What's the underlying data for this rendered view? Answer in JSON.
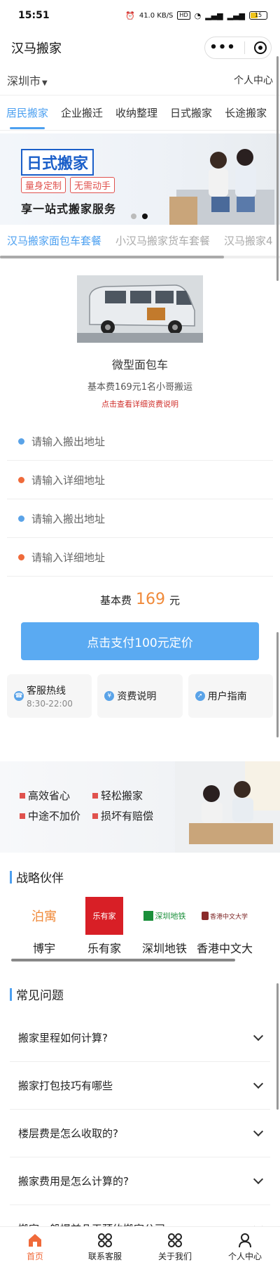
{
  "status_bar": {
    "time": "15:51",
    "speed": "41.0 KB/S",
    "hd": "HD",
    "battery": "15"
  },
  "nav": {
    "title": "汉马搬家",
    "more_icon": "more-dots-icon",
    "close_icon": "target-close-icon"
  },
  "header": {
    "city": "深圳市",
    "personal_center": "个人中心"
  },
  "tabs": [
    "居民搬家",
    "企业搬迁",
    "收纳整理",
    "日式搬家",
    "长途搬家"
  ],
  "banner": {
    "title": "日式搬家",
    "tags": [
      "量身定制",
      "无需动手"
    ],
    "subtitle": "享一站式搬家服务"
  },
  "package_tabs": [
    "汉马搬家面包车套餐",
    "小汉马搬家货车套餐",
    "汉马搬家4"
  ],
  "vehicle": {
    "name": "微型面包车",
    "desc": "基本费169元1名小哥搬运",
    "fee_link": "点击查看详细资费说明"
  },
  "addresses": [
    {
      "placeholder": "请输入搬出地址",
      "color": "blue"
    },
    {
      "placeholder": "请输入详细地址",
      "color": "orange"
    },
    {
      "placeholder": "请输入搬出地址",
      "color": "blue"
    },
    {
      "placeholder": "请输入详细地址",
      "color": "orange"
    }
  ],
  "price": {
    "label": "基本费",
    "amount": "169",
    "unit": "元"
  },
  "pay_button": "点击支付100元定价",
  "services": [
    {
      "label": "客服热线",
      "sub": "8:30-22:00",
      "icon": "phone-icon"
    },
    {
      "label": "资费说明",
      "sub": "",
      "icon": "yen-icon"
    },
    {
      "label": "用户指南",
      "sub": "",
      "icon": "compass-icon"
    }
  ],
  "promo": [
    "高效省心",
    "轻松搬家",
    "中途不加价",
    "损坏有赔偿"
  ],
  "partners_title": "战略伙伴",
  "partners": [
    {
      "name": "博宇",
      "logo": "泊寓"
    },
    {
      "name": "乐有家",
      "logo": "乐有家"
    },
    {
      "name": "深圳地铁",
      "logo": "深圳地铁"
    },
    {
      "name": "香港中文大",
      "logo": "香港中文大学"
    }
  ],
  "faq_title": "常见问题",
  "faq": [
    "搬家里程如何计算?",
    "搬家打包技巧有哪些",
    "楼层费是怎么收取的?",
    "搬家费用是怎么计算的?",
    "搬家一般提前几天预约搬家公司"
  ],
  "tabbar": [
    {
      "label": "首页",
      "icon": "home-icon"
    },
    {
      "label": "联系客服",
      "icon": "grid-icon"
    },
    {
      "label": "关于我们",
      "icon": "grid-icon"
    },
    {
      "label": "个人中心",
      "icon": "user-icon"
    }
  ],
  "colors": {
    "accent": "#4da0f0",
    "price": "#f08a3a",
    "link_red": "#d0312d",
    "tab_active": "#f06a3a"
  }
}
